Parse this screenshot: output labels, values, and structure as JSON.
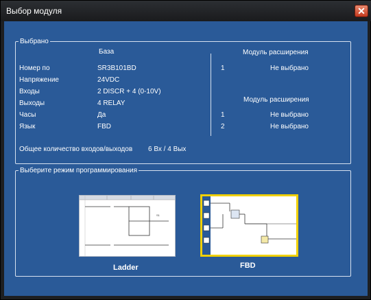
{
  "window": {
    "title": "Выбор модуля"
  },
  "selected": {
    "legend": "Выбрано",
    "base_header": "База",
    "rows": [
      {
        "label": "Номер по",
        "value": "SR3B101BD"
      },
      {
        "label": "Напряжение",
        "value": "24VDC"
      },
      {
        "label": "Входы",
        "value": "2 DISCR + 4 (0-10V)"
      },
      {
        "label": "Выходы",
        "value": "4 RELAY"
      },
      {
        "label": "Часы",
        "value": "Да"
      },
      {
        "label": "Язык",
        "value": "FBD"
      }
    ],
    "total_label": "Общее количество входов/выходов",
    "total_value": "6 Вх / 4 Вых",
    "expansion1": {
      "header": "Модуль расширения",
      "items": [
        {
          "num": "1",
          "value": "Не выбрано"
        }
      ]
    },
    "expansion2": {
      "header": "Модуль расширения",
      "items": [
        {
          "num": "1",
          "value": "Не выбрано"
        },
        {
          "num": "2",
          "value": "Не выбрано"
        }
      ]
    }
  },
  "mode": {
    "legend": "Выберите режим программирования",
    "options": [
      {
        "label": "Ladder",
        "selected": false
      },
      {
        "label": "FBD",
        "selected": true
      }
    ]
  },
  "colors": {
    "client_bg": "#2a5a98",
    "selection_border": "#f0d000",
    "close_button": "#c4391e"
  }
}
